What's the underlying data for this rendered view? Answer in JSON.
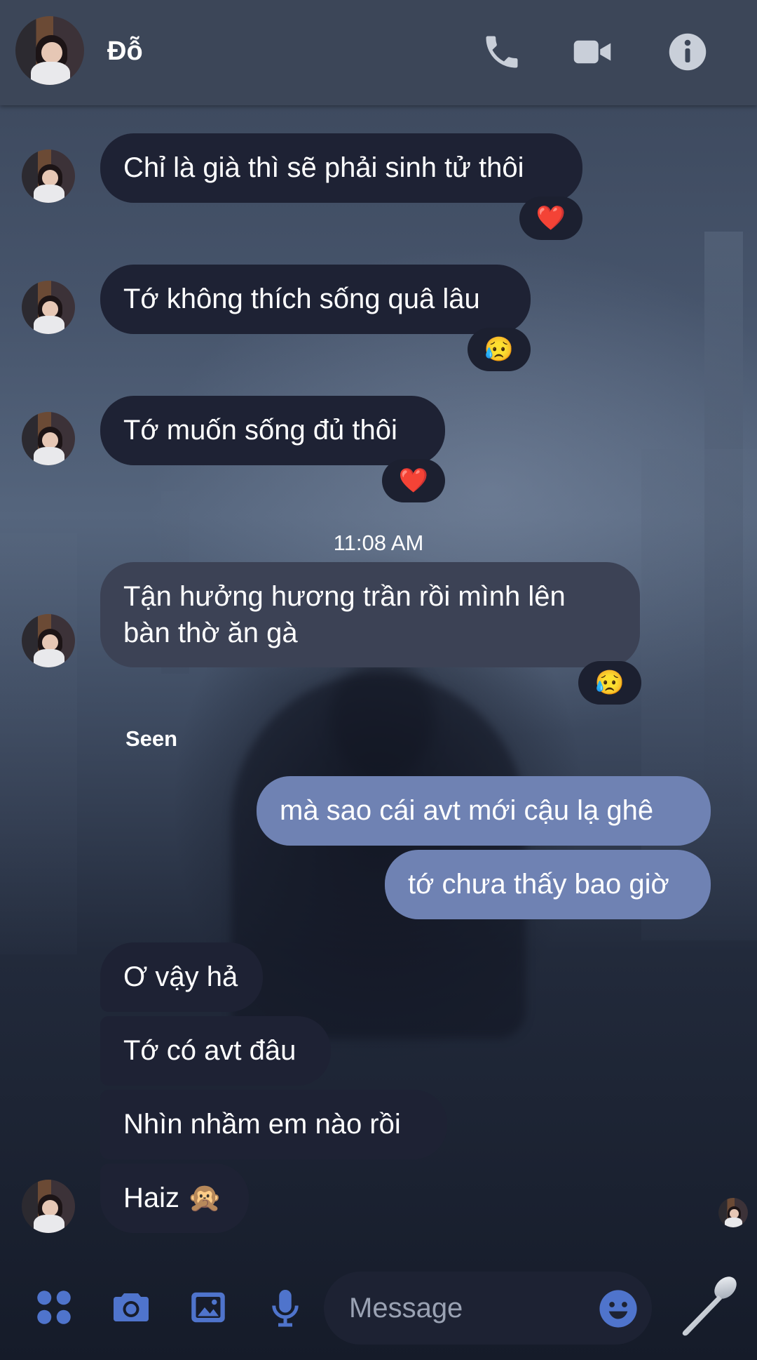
{
  "header": {
    "contact_name": "Đỗ",
    "icons": [
      "phone-icon",
      "video-camera-icon",
      "info-icon"
    ]
  },
  "messages": [
    {
      "text": "Chỉ là già thì sẽ phải sinh tử thôi",
      "reaction": "❤️"
    },
    {
      "text": "Tớ không thích sống quâ lâu",
      "reaction": "😥"
    },
    {
      "text": "Tớ muốn sống đủ thôi",
      "reaction": "❤️"
    },
    {
      "timestamp": "11:08 AM"
    },
    {
      "text_line1": "Tận hưởng hương trần rồi mình lên",
      "text_line2": "bàn thờ ăn gà",
      "reaction": "😥"
    },
    {
      "status": "Seen"
    },
    {
      "text": "mà sao cái avt mới cậu lạ ghê",
      "from": "me"
    },
    {
      "text": "tớ chưa thấy bao giờ",
      "from": "me"
    },
    {
      "text": "Ơ vậy hả"
    },
    {
      "text": "Tớ có avt đâu"
    },
    {
      "text": "Nhìn nhầm em nào rồi"
    },
    {
      "text": "Haiz 🙊"
    }
  ],
  "composer": {
    "placeholder": "Message",
    "icons": [
      "apps-icon",
      "camera-icon",
      "gallery-icon",
      "microphone-icon",
      "emoji-icon",
      "spoon-icon"
    ]
  },
  "colors": {
    "header_bg": "#3c4658",
    "incoming_bubble": "#1e2234",
    "outgoing_bubble": "#6f82b3",
    "accent": "#4f74cc"
  }
}
